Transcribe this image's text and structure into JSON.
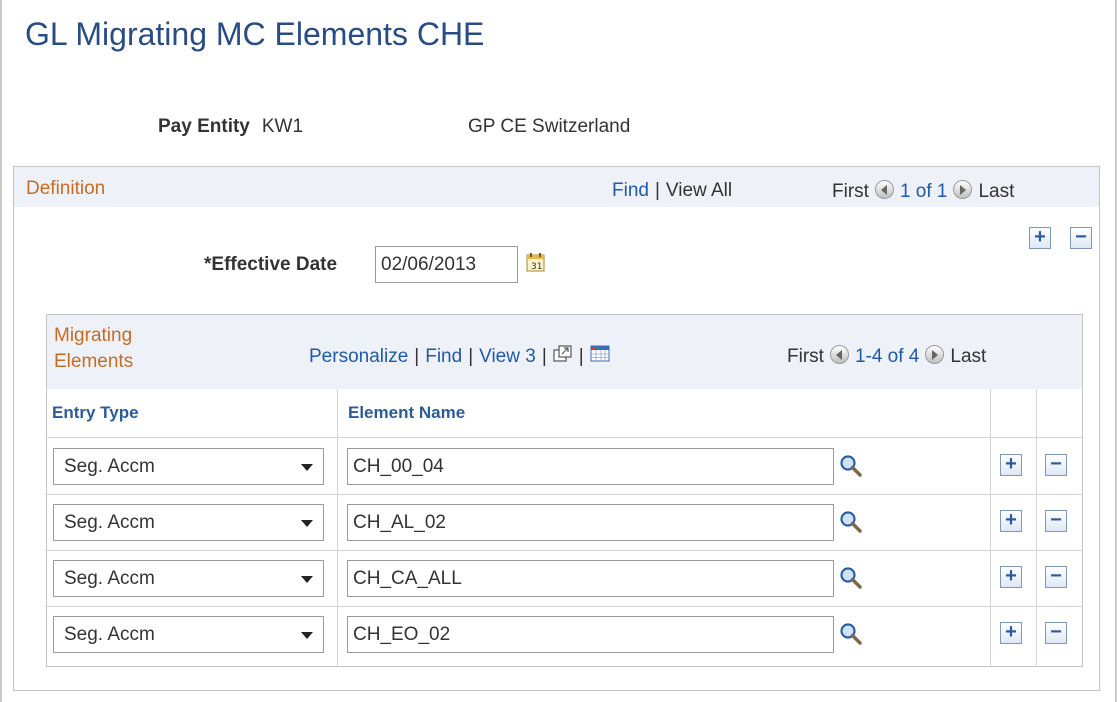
{
  "page": {
    "title": "GL Migrating MC Elements CHE"
  },
  "pay_entity": {
    "label": "Pay Entity",
    "code": "KW1",
    "description": "GP CE Switzerland"
  },
  "definition": {
    "title": "Definition",
    "nav": {
      "find": "Find",
      "view_all": "View All",
      "first": "First",
      "range": "1 of 1",
      "last": "Last"
    },
    "add_symbol": "+",
    "remove_symbol": "−",
    "effective_date": {
      "label": "*Effective Date",
      "value": "02/06/2013",
      "icon": "calendar-icon"
    }
  },
  "grid": {
    "title": "Migrating Elements",
    "nav": {
      "personalize": "Personalize",
      "find": "Find",
      "view": "View 3",
      "first": "First",
      "range": "1-4 of 4",
      "last": "Last"
    },
    "columns": {
      "entry_type": "Entry Type",
      "element_name": "Element Name"
    },
    "rows": [
      {
        "entry_type": "Seg. Accm",
        "element_name": "CH_00_04"
      },
      {
        "entry_type": "Seg. Accm",
        "element_name": "CH_AL_02"
      },
      {
        "entry_type": "Seg. Accm",
        "element_name": "CH_CA_ALL"
      },
      {
        "entry_type": "Seg. Accm",
        "element_name": "CH_EO_02"
      }
    ]
  },
  "colors": {
    "title": "#284d85",
    "section_title": "#c76b22",
    "link": "#1f5aa6",
    "header_bg": "#eef2f8"
  }
}
